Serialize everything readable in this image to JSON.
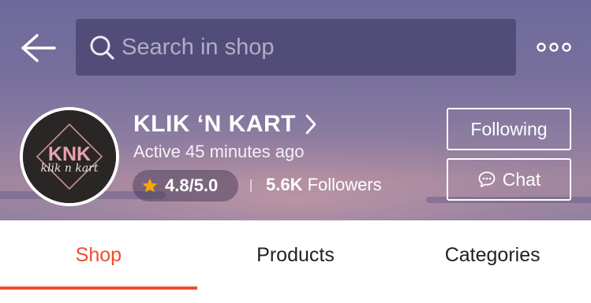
{
  "header": {
    "search": {
      "placeholder": "Search in shop"
    },
    "icons": {
      "back": "arrow-left-icon",
      "search": "search-icon",
      "more": "more-dots-icon"
    }
  },
  "shop": {
    "logo": {
      "initials": "KNK",
      "script": "klik n kart"
    },
    "name": "KLIK ‘N KART",
    "active_status": "Active 45 minutes ago",
    "rating": "4.8/5.0",
    "followers_count": "5.6K",
    "followers_label": "Followers"
  },
  "actions": {
    "following_label": "Following",
    "chat_label": "Chat"
  },
  "tabs": [
    {
      "label": "Shop",
      "active": true
    },
    {
      "label": "Products",
      "active": false
    },
    {
      "label": "Categories",
      "active": false
    }
  ],
  "colors": {
    "accent": "#ee4d2d",
    "star": "#f6a700"
  }
}
